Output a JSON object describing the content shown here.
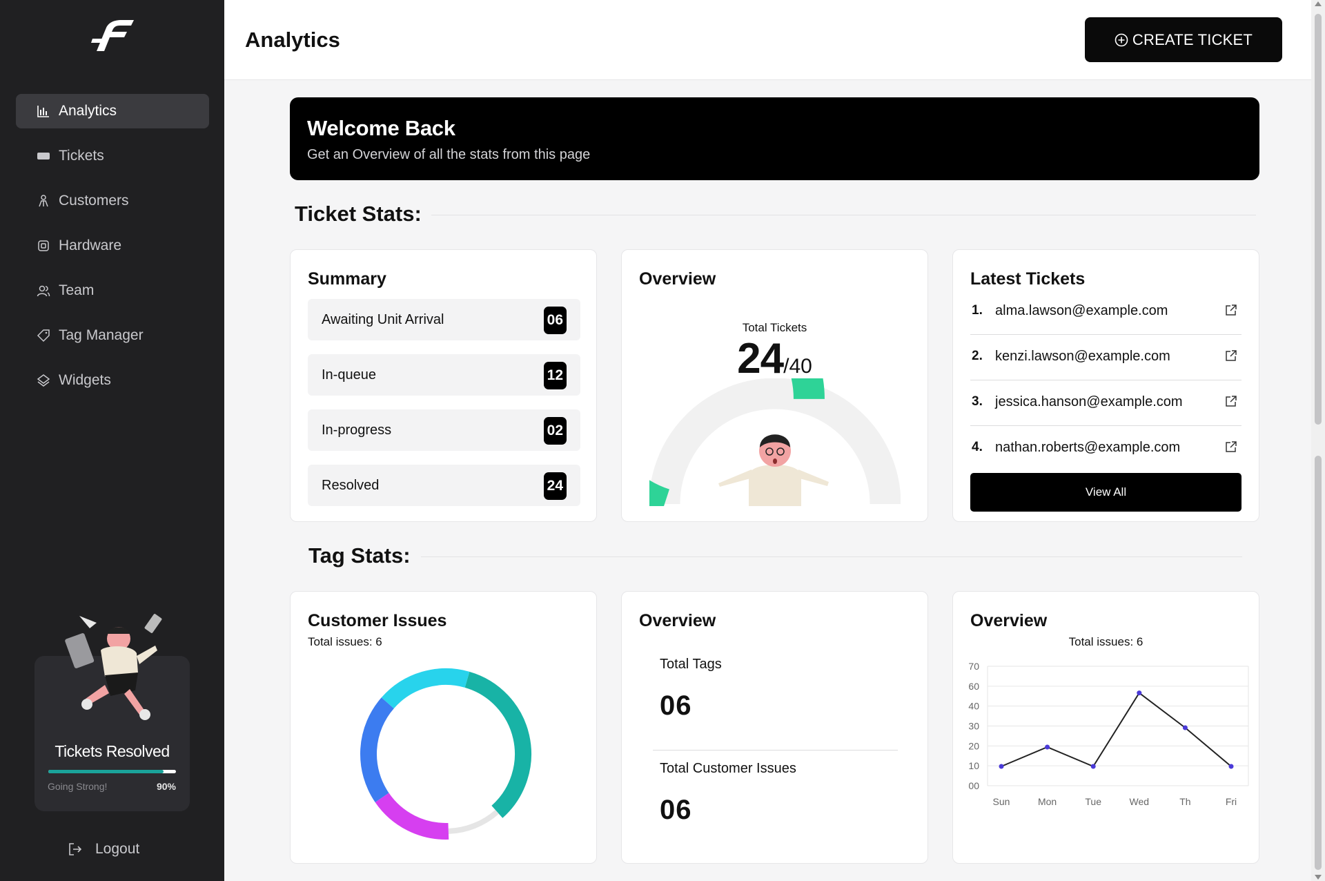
{
  "sidebar": {
    "items": [
      {
        "label": "Analytics",
        "icon": "bar-chart-icon",
        "active": true
      },
      {
        "label": "Tickets",
        "icon": "ticket-icon"
      },
      {
        "label": "Customers",
        "icon": "customers-icon"
      },
      {
        "label": "Hardware",
        "icon": "chip-icon"
      },
      {
        "label": "Team",
        "icon": "team-icon"
      },
      {
        "label": "Tag Manager",
        "icon": "tag-icon"
      },
      {
        "label": "Widgets",
        "icon": "widgets-icon"
      }
    ],
    "promo": {
      "title": "Tickets Resolved",
      "subtitle": "Going Strong!",
      "percent_label": "90%",
      "progress": 0.9
    },
    "logout": "Logout"
  },
  "header": {
    "title": "Analytics",
    "create_button": "CREATE TICKET"
  },
  "welcome": {
    "title": "Welcome Back",
    "subtitle": "Get an Overview of all the stats from this page"
  },
  "ticket_stats": {
    "heading": "Ticket Stats:",
    "summary": {
      "title": "Summary",
      "rows": [
        {
          "label": "Awaiting Unit Arrival",
          "count": "06"
        },
        {
          "label": "In-queue",
          "count": "12"
        },
        {
          "label": "In-progress",
          "count": "02"
        },
        {
          "label": "Resolved",
          "count": "24"
        }
      ]
    },
    "overview": {
      "title": "Overview",
      "label": "Total Tickets",
      "value": "24",
      "total": "/40",
      "fraction": 0.6
    },
    "latest": {
      "title": "Latest Tickets",
      "items": [
        {
          "num": "1.",
          "email": "alma.lawson@example.com"
        },
        {
          "num": "2.",
          "email": "kenzi.lawson@example.com"
        },
        {
          "num": "3.",
          "email": "jessica.hanson@example.com"
        },
        {
          "num": "4.",
          "email": "nathan.roberts@example.com"
        }
      ],
      "view_all": "View All"
    }
  },
  "tag_stats": {
    "heading": "Tag Stats:",
    "customer_issues": {
      "title": "Customer Issues",
      "subtitle": "Total issues: 6"
    },
    "overview": {
      "title": "Overview",
      "tags_label": "Total Tags",
      "tags_value": "06",
      "issues_label": "Total Customer Issues",
      "issues_value": "06"
    },
    "line_overview": {
      "title": "Overview",
      "subtitle": "Total issues: 6"
    }
  },
  "colors": {
    "accent_green": "#2ed397",
    "teal": "#18b3a6",
    "cyan": "#28d3ec",
    "blue": "#3c7cf0",
    "magenta": "#d63ff0",
    "line_point": "#4a3ad8"
  },
  "chart_data": [
    {
      "type": "pie",
      "title": "Customer Issues",
      "values": [
        34,
        11,
        16,
        21,
        18
      ],
      "colors": [
        "#18b3a6",
        "#e5e5e5",
        "#d63ff0",
        "#3c7cf0",
        "#28d3ec"
      ]
    },
    {
      "type": "line",
      "title": "Overview",
      "categories": [
        "Sun",
        "Mon",
        "Tue",
        "Wed",
        "Th",
        "Fri"
      ],
      "series": [
        {
          "values": [
            10,
            20,
            10,
            48,
            30,
            10
          ]
        }
      ],
      "y_tick_labels": [
        "00",
        "10",
        "20",
        "30",
        "40",
        "60",
        "70"
      ],
      "ylim": [
        0,
        60
      ],
      "grid": true
    }
  ]
}
